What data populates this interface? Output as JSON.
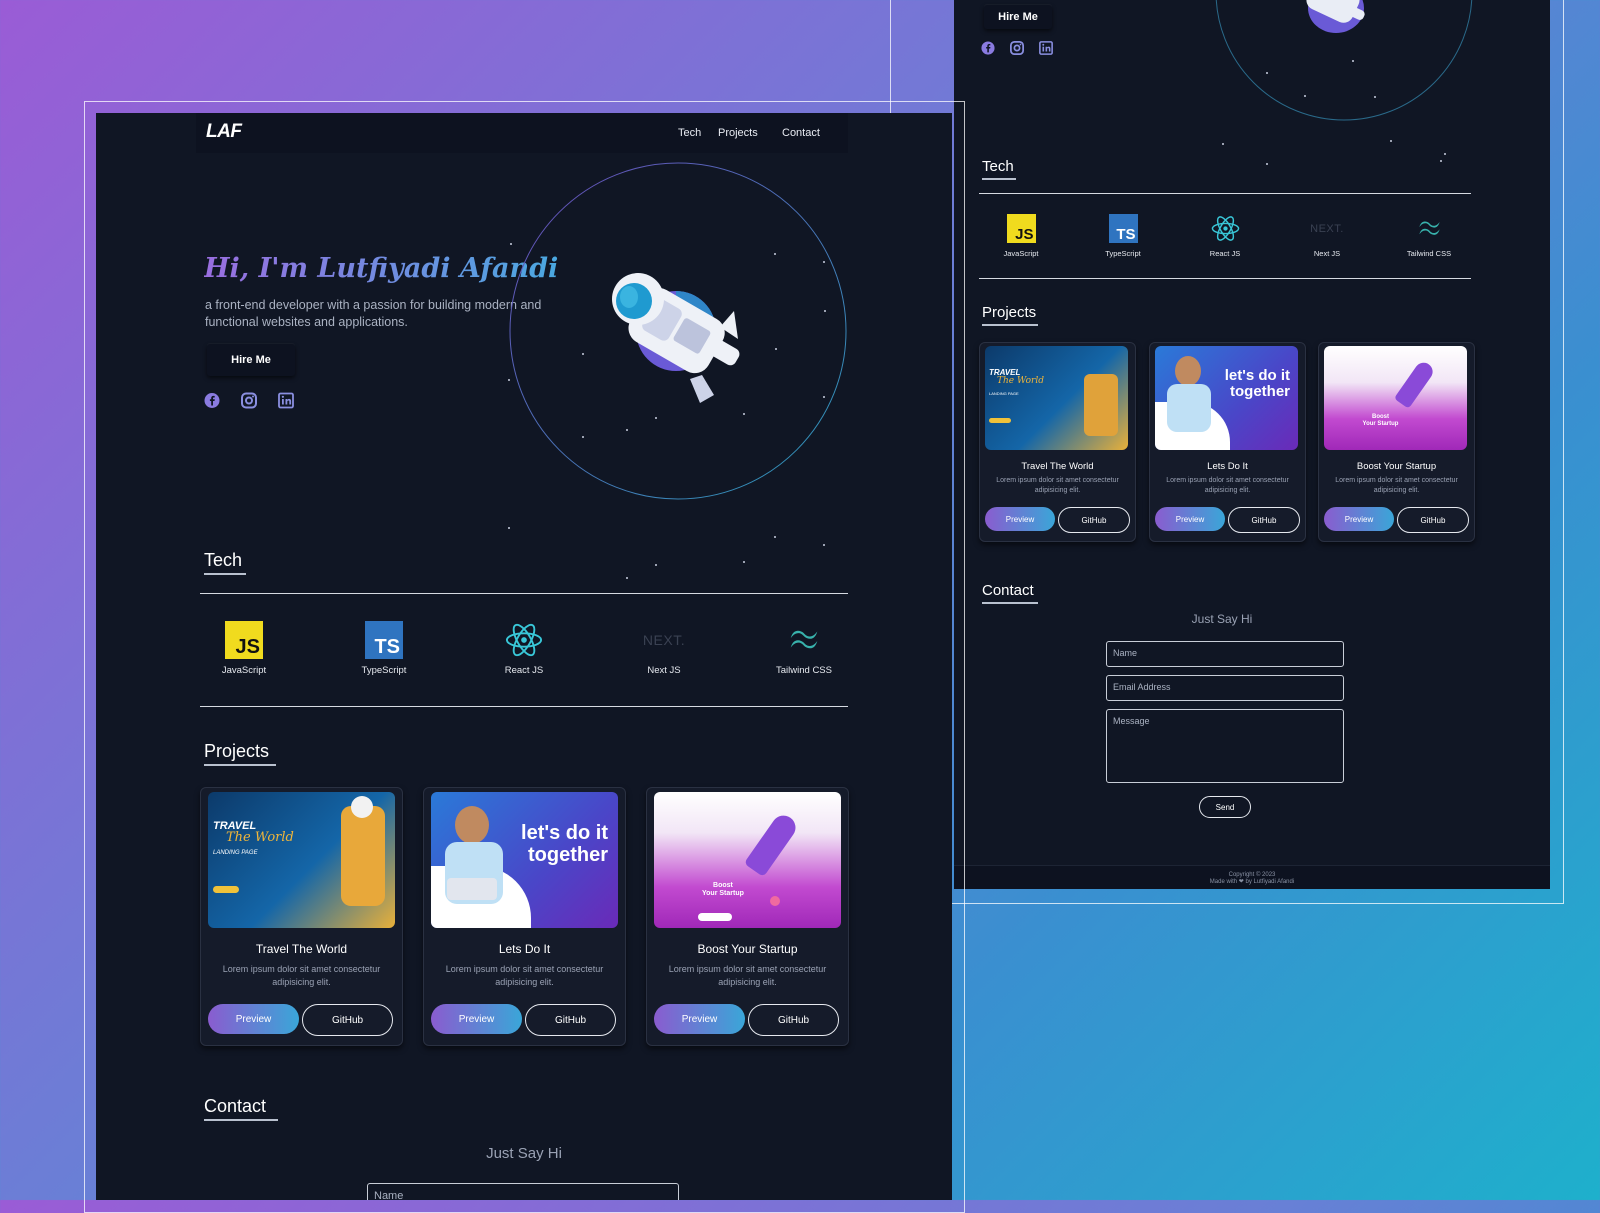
{
  "nav": {
    "logo": "LAF",
    "links": [
      "Tech",
      "Projects",
      "Contact"
    ]
  },
  "hero": {
    "title": "Hi, I'm Lutfiyadi Afandi",
    "subtitle_line1": "a front-end developer with a passion for building modern and",
    "subtitle_line2": "functional websites and applications.",
    "hire_button": "Hire Me",
    "social_icons": [
      "facebook-icon",
      "instagram-icon",
      "linkedin-icon"
    ]
  },
  "tech": {
    "title": "Tech",
    "items": [
      {
        "label": "JavaScript",
        "icon": "js-icon",
        "badge": "JS",
        "color": "#f0db1e"
      },
      {
        "label": "TypeScript",
        "icon": "ts-icon",
        "badge": "TS",
        "color": "#2f74c0"
      },
      {
        "label": "React JS",
        "icon": "react-icon",
        "color": "#39c7d8"
      },
      {
        "label": "Next JS",
        "icon": "nextjs-icon",
        "badge": "NEXT.",
        "color": "#3a4152"
      },
      {
        "label": "Tailwind CSS",
        "icon": "tailwind-icon",
        "color": "#38b2ac"
      }
    ]
  },
  "projects": {
    "title": "Projects",
    "preview_label": "Preview",
    "github_label": "GitHub",
    "items": [
      {
        "title": "Travel The World",
        "desc_line1": "Lorem ipsum dolor sit amet consectetur",
        "desc_line2": "adipisicing elit.",
        "img_line1": "TRAVEL",
        "img_line2": "The World",
        "img_line3": "LANDING PAGE"
      },
      {
        "title": "Lets Do It",
        "desc_line1": "Lorem ipsum dolor sit amet consectetur",
        "desc_line2": "adipisicing elit.",
        "img_line1": "let's do it",
        "img_line2": "together"
      },
      {
        "title": "Boost Your Startup",
        "desc_line1": "Lorem ipsum dolor sit amet consectetur",
        "desc_line2": "adipisicing elit.",
        "img_line1": "Boost",
        "img_line2": "Your Startup"
      }
    ]
  },
  "contact": {
    "title": "Contact",
    "subtitle": "Just Say Hi",
    "name_placeholder": "Name",
    "email_placeholder": "Email Address",
    "message_placeholder": "Message",
    "send_label": "Send"
  },
  "footer": {
    "copyright": "Copyright © 2023",
    "made_with": "Made with ❤ by Lutfiyadi Afandi"
  },
  "colors": {
    "page_bg": "#101624",
    "accent_purple": "#8a5ccf",
    "accent_blue": "#3aa6d8"
  }
}
